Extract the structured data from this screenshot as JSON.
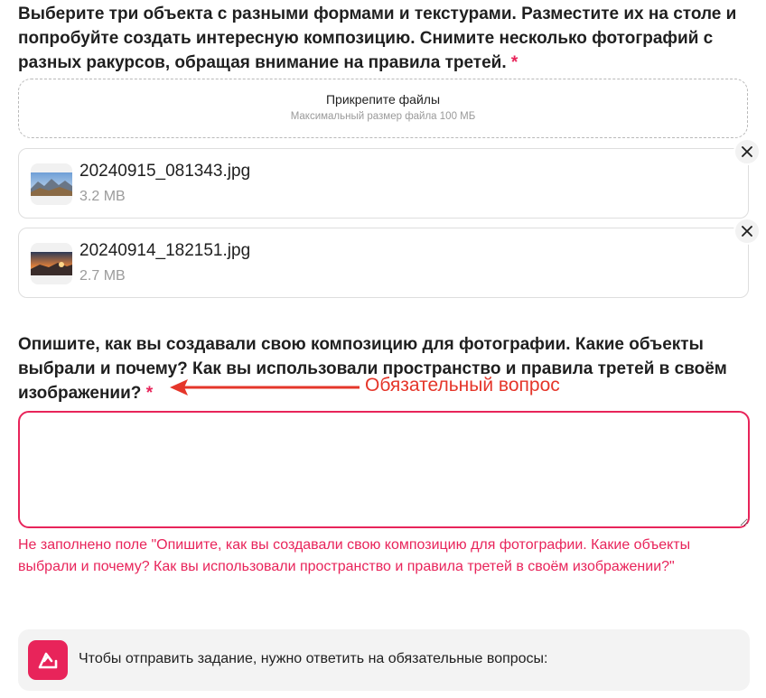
{
  "question1": {
    "text": "Выберите три объекта с разными формами и текстурами. Разместите их на столе и попробуйте создать интересную композицию. Снимите несколько фотографий с разных ракурсов, обращая внимание на правила третей.",
    "required_mark": "*"
  },
  "upload": {
    "title": "Прикрепите файлы",
    "subtitle": "Максимальный размер файла 100 МБ"
  },
  "files": [
    {
      "name": "20240915_081343.jpg",
      "size": "3.2 MB",
      "thumb_icon": "mountain-landscape-thumbnail"
    },
    {
      "name": "20240914_182151.jpg",
      "size": "2.7 MB",
      "thumb_icon": "sunset-landscape-thumbnail"
    }
  ],
  "question2": {
    "text": "Опишите, как вы создавали свою композицию для фотографии. Какие объекты выбрали и почему? Как вы использовали пространство и правила третей в своём изображении?",
    "required_mark": "*"
  },
  "annotation": {
    "text": "Обязательный вопрос"
  },
  "answer": {
    "value": ""
  },
  "error": {
    "text": "Не заполнено поле \"Опишите, как вы создавали свою композицию для фотографии. Какие объекты выбрали и почему? Как вы использовали пространство и правила третей в своём изображении?\""
  },
  "notice": {
    "text": "Чтобы отправить задание, нужно ответить на обязательные вопросы:",
    "icon": "brand-logo-icon"
  },
  "colors": {
    "accent": "#e8245a",
    "annotation": "#e5362a",
    "muted_text": "#9b9b9b"
  }
}
